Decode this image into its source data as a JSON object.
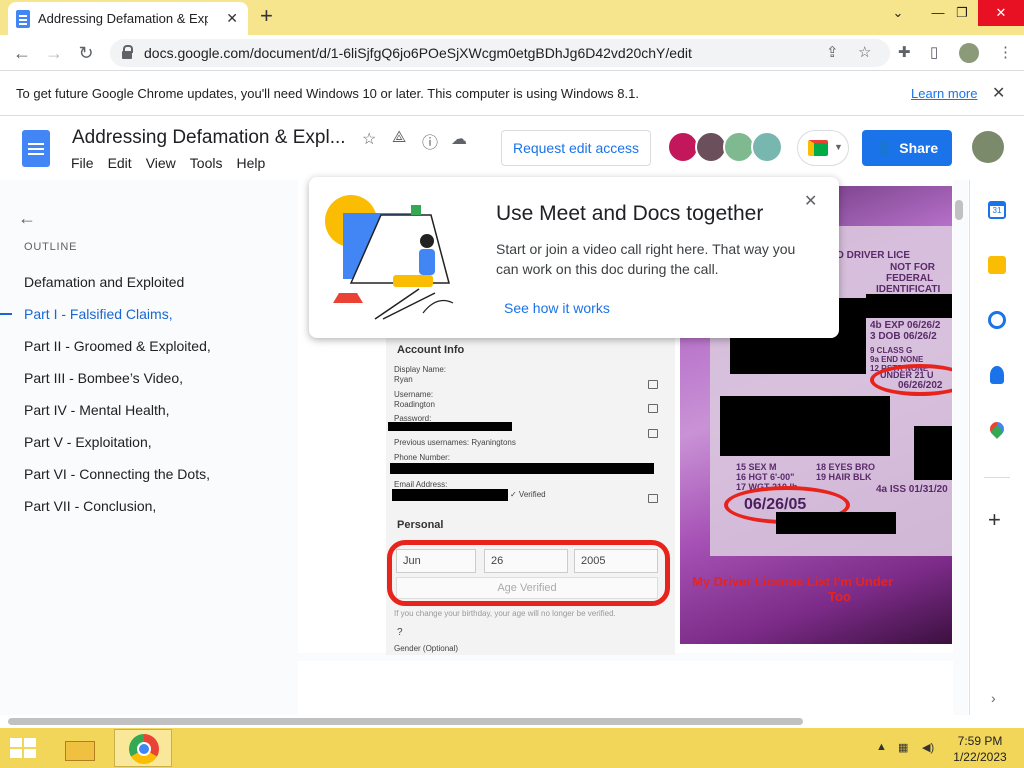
{
  "browser": {
    "tab_title": "Addressing Defamation & Exploit",
    "tab_close": "✕",
    "new_tab": "+",
    "url": "docs.google.com/document/d/1-6liSjfgQ6jo6POeSjXWcgm0etgBDhJg6D42vd20chY/edit",
    "window_controls": {
      "minimize": "⌄",
      "minimize2": "—",
      "restore": "❐",
      "close": "✕"
    }
  },
  "infobar": {
    "message": "To get future Google Chrome updates, you'll need Windows 10 or later. This computer is using Windows 8.1.",
    "learn_more": "Learn more",
    "close": "✕"
  },
  "docs": {
    "title": "Addressing Defamation & Expl...",
    "menu": [
      "File",
      "Edit",
      "View",
      "Tools",
      "Help"
    ],
    "request_edit": "Request edit access",
    "share": "Share",
    "share_icon": "person-icon"
  },
  "outline": {
    "label": "OUTLINE",
    "items": [
      "Defamation and Exploited",
      "Part I - Falsified Claims,",
      "Part II - Groomed & Exploited,",
      "Part III - Bombee’s Video,",
      "Part IV - Mental Health,",
      "Part V - Exploitation,",
      "Part VI - Connecting the Dots,",
      "Part VII - Conclusion,"
    ],
    "active_index": 1
  },
  "meet_popup": {
    "title": "Use Meet and Docs together",
    "body": "Start or join a video call right here. That way you can work on this doc during the call.",
    "link": "See how it works",
    "close": "✕"
  },
  "embedded_account": {
    "heading": "Account Info",
    "display_name_label": "Display Name:",
    "display_name": "Ryan",
    "username_label": "Username:",
    "username": "Roadington",
    "password_label": "Password:",
    "prev_usernames": "Previous usernames: Ryaningtons",
    "phone_label": "Phone Number:",
    "email_label": "Email Address:",
    "verified": "✓ Verified",
    "personal": "Personal",
    "month": "Jun",
    "day": "26",
    "year": "2005",
    "age_verified": "Age Verified",
    "note": "If you change your birthday, your age will no longer be verified.",
    "gender": "Gender (Optional)"
  },
  "embedded_photo": {
    "license_header": "ED DRIVER LICE",
    "not_for": "NOT FOR",
    "federal": "FEDERAL",
    "identification": "IDENTIFICATI",
    "exp": "4b EXP 06/26/2",
    "dob": "3 DOB 06/26/2",
    "class": "9 CLASS G",
    "end": "9a END  NONE",
    "restr": "12 RSTR  NONE",
    "under21": "UNDER 21 U",
    "under21_date": "06/26/202",
    "sex": "15 SEX  M",
    "hgt": "16 HGT  6'-00\"",
    "wgt": "17 WGT  210 lb",
    "eyes": "18 EYES BRO",
    "hair": "19 HAIR BLK",
    "iss": "4a ISS 01/31/20",
    "dob_big": "06/26/05",
    "caption_line1": "My Driver License List I'm Under",
    "caption_line2": "Too"
  },
  "taskbar": {
    "time": "7:59 PM",
    "date": "1/22/2023"
  },
  "colors": {
    "titlebar": "#f6e58d",
    "taskbar": "#f2d65a",
    "accent": "#1a73e8",
    "red_oval": "#e8231c"
  }
}
